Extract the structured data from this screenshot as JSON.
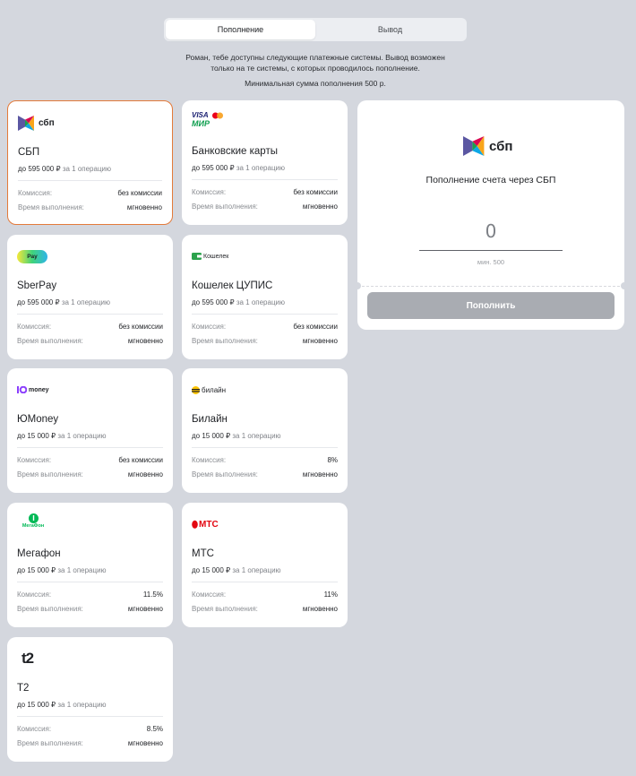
{
  "tabs": {
    "deposit": "Пополнение",
    "withdraw": "Вывод"
  },
  "notice": {
    "line1": "Роман, тебе доступны следующие платежные системы. Вывод возможен",
    "line2": "только на те системы, с которых проводилось пополнение.",
    "min": "Минимальная сумма пополнения 500 р."
  },
  "labels": {
    "commission": "Комиссия:",
    "time": "Время выполнения:",
    "per_op": "за 1 операцию"
  },
  "methods": [
    {
      "name": "СБП",
      "limit": "до 595 000 ₽",
      "commission": "без комиссии",
      "time": "мгновенно",
      "logo": "sbp-logo"
    },
    {
      "name": "Банковские карты",
      "limit": "до 595 000 ₽",
      "commission": "без комиссии",
      "time": "мгновенно",
      "logo": "visa-mir-logo"
    },
    {
      "name": "SberPay",
      "limit": "до 595 000 ₽",
      "commission": "без комиссии",
      "time": "мгновенно",
      "logo": "sberpay-logo"
    },
    {
      "name": "Кошелек ЦУПИС",
      "limit": "до 595 000 ₽",
      "commission": "без комиссии",
      "time": "мгновенно",
      "logo": "koshelek-logo"
    },
    {
      "name": "ЮMoney",
      "limit": "до 15 000 ₽",
      "commission": "без комиссии",
      "time": "мгновенно",
      "logo": "yumoney-logo"
    },
    {
      "name": "Билайн",
      "limit": "до 15 000 ₽",
      "commission": "8%",
      "time": "мгновенно",
      "logo": "beeline-logo"
    },
    {
      "name": "Мегафон",
      "limit": "до 15 000 ₽",
      "commission": "11.5%",
      "time": "мгновенно",
      "logo": "megafon-logo"
    },
    {
      "name": "МТС",
      "limit": "до 15 000 ₽",
      "commission": "11%",
      "time": "мгновенно",
      "logo": "mts-logo"
    },
    {
      "name": "T2",
      "limit": "до 15 000 ₽",
      "commission": "8.5%",
      "time": "мгновенно",
      "logo": "t2-logo"
    }
  ],
  "logos": {
    "sbp": "сбп",
    "visa": "VISA",
    "mir": "МИР",
    "sberpay": "Pay",
    "koshelek": "Кошелек",
    "yumoney": "money",
    "beeline": "билайн",
    "megafon": "МегаФон",
    "mts": "МТС",
    "t2": "t2"
  },
  "panel": {
    "title": "Пополнение счета через СБП",
    "amount": "0",
    "min_hint": "мин. 500",
    "button": "Пополнить"
  },
  "colors": {
    "selected_border": "#e37a3a",
    "button_disabled": "#a9acb2",
    "background": "#d4d7de"
  }
}
